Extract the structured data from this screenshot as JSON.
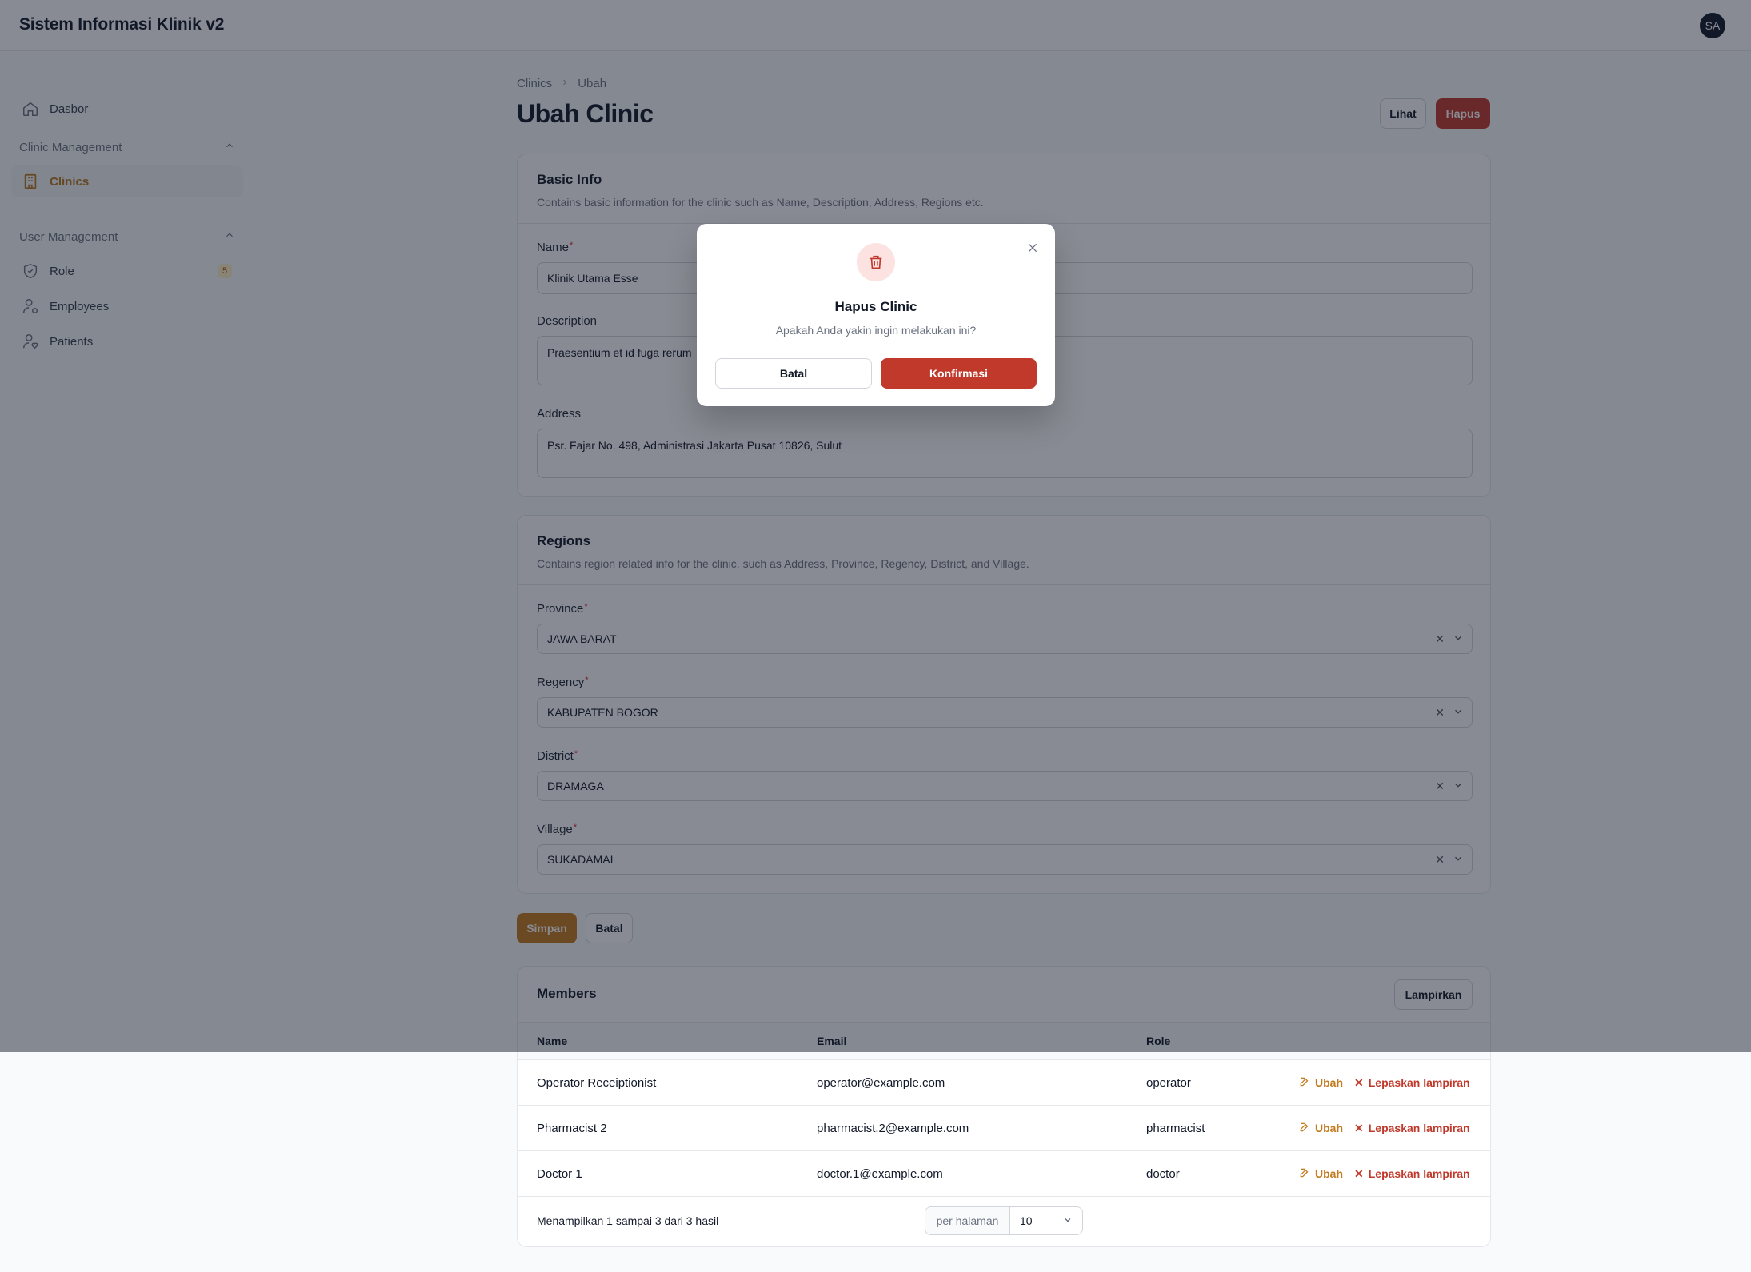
{
  "app": {
    "title": "Sistem Informasi Klinik v2",
    "avatar_initials": "SA"
  },
  "sidebar": {
    "dashboard": {
      "label": "Dasbor",
      "icon": "home-icon"
    },
    "groups": [
      {
        "label": "Clinic Management",
        "items": [
          {
            "label": "Clinics",
            "icon": "building-icon",
            "active": true
          }
        ]
      },
      {
        "label": "User Management",
        "items": [
          {
            "label": "Role",
            "icon": "shield-icon",
            "badge": "5"
          },
          {
            "label": "Employees",
            "icon": "user-cog-icon"
          },
          {
            "label": "Patients",
            "icon": "user-heart-icon"
          }
        ]
      }
    ]
  },
  "breadcrumb": [
    "Clinics",
    "Ubah"
  ],
  "page": {
    "title": "Ubah Clinic",
    "view_button": "Lihat",
    "delete_button": "Hapus"
  },
  "basic_info": {
    "title": "Basic Info",
    "description": "Contains basic information for the clinic such as Name, Description, Address, Regions etc.",
    "name_label": "Name",
    "name_value": "Klinik Utama Esse",
    "description_label": "Description",
    "description_value": "Praesentium et id fuga rerum",
    "address_label": "Address",
    "address_value": "Psr. Fajar No. 498, Administrasi Jakarta Pusat 10826, Sulut"
  },
  "regions": {
    "title": "Regions",
    "description": "Contains region related info for the clinic, such as Address, Province, Regency, District, and Village.",
    "fields": [
      {
        "label": "Province",
        "value": "JAWA BARAT"
      },
      {
        "label": "Regency",
        "value": "KABUPATEN BOGOR"
      },
      {
        "label": "District",
        "value": "DRAMAGA"
      },
      {
        "label": "Village",
        "value": "SUKADAMAI"
      }
    ]
  },
  "form_actions": {
    "save": "Simpan",
    "cancel": "Batal"
  },
  "members": {
    "title": "Members",
    "attach_button": "Lampirkan",
    "columns": [
      "Name",
      "Email",
      "Role"
    ],
    "rows": [
      {
        "name": "Operator Receiptionist",
        "email": "operator@example.com",
        "role": "operator"
      },
      {
        "name": "Pharmacist 2",
        "email": "pharmacist.2@example.com",
        "role": "pharmacist"
      },
      {
        "name": "Doctor 1",
        "email": "doctor.1@example.com",
        "role": "doctor"
      }
    ],
    "edit_label": "Ubah",
    "detach_label": "Lepaskan lampiran",
    "footer_text": "Menampilkan 1 sampai 3 dari 3 hasil",
    "per_page_label": "per halaman",
    "per_page_value": "10"
  },
  "modal": {
    "title": "Hapus Clinic",
    "message": "Apakah Anda yakin ingin melakukan ini?",
    "cancel": "Batal",
    "confirm": "Konfirmasi",
    "icon": "trash-icon"
  },
  "colors": {
    "primary": "#c47a1e",
    "danger": "#c0392b",
    "overlay": "rgba(17,24,39,0.5)"
  }
}
